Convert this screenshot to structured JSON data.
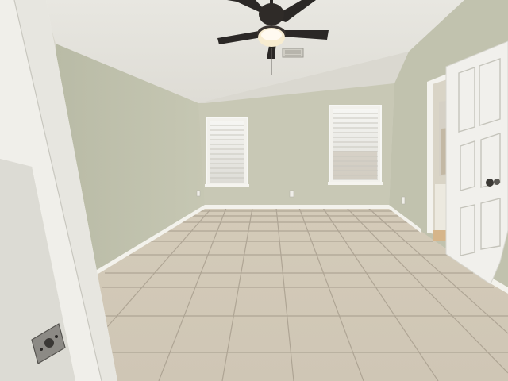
{
  "scene": {
    "subject": "empty bedroom",
    "colors": {
      "ceiling": "#e4e3dd",
      "wall_left": "#bfc0ac",
      "wall_back": "#c9c9b6",
      "wall_right": "#c2c3b0",
      "floor_tile": "#d9d0bf",
      "grout": "#a89f8f",
      "trim": "#f4f3ee",
      "fan_blade": "#2b2826",
      "door": "#f1f0ec"
    },
    "icons": [
      "ceiling-fan-icon",
      "door-knob-icon",
      "latch-plate-icon"
    ]
  }
}
